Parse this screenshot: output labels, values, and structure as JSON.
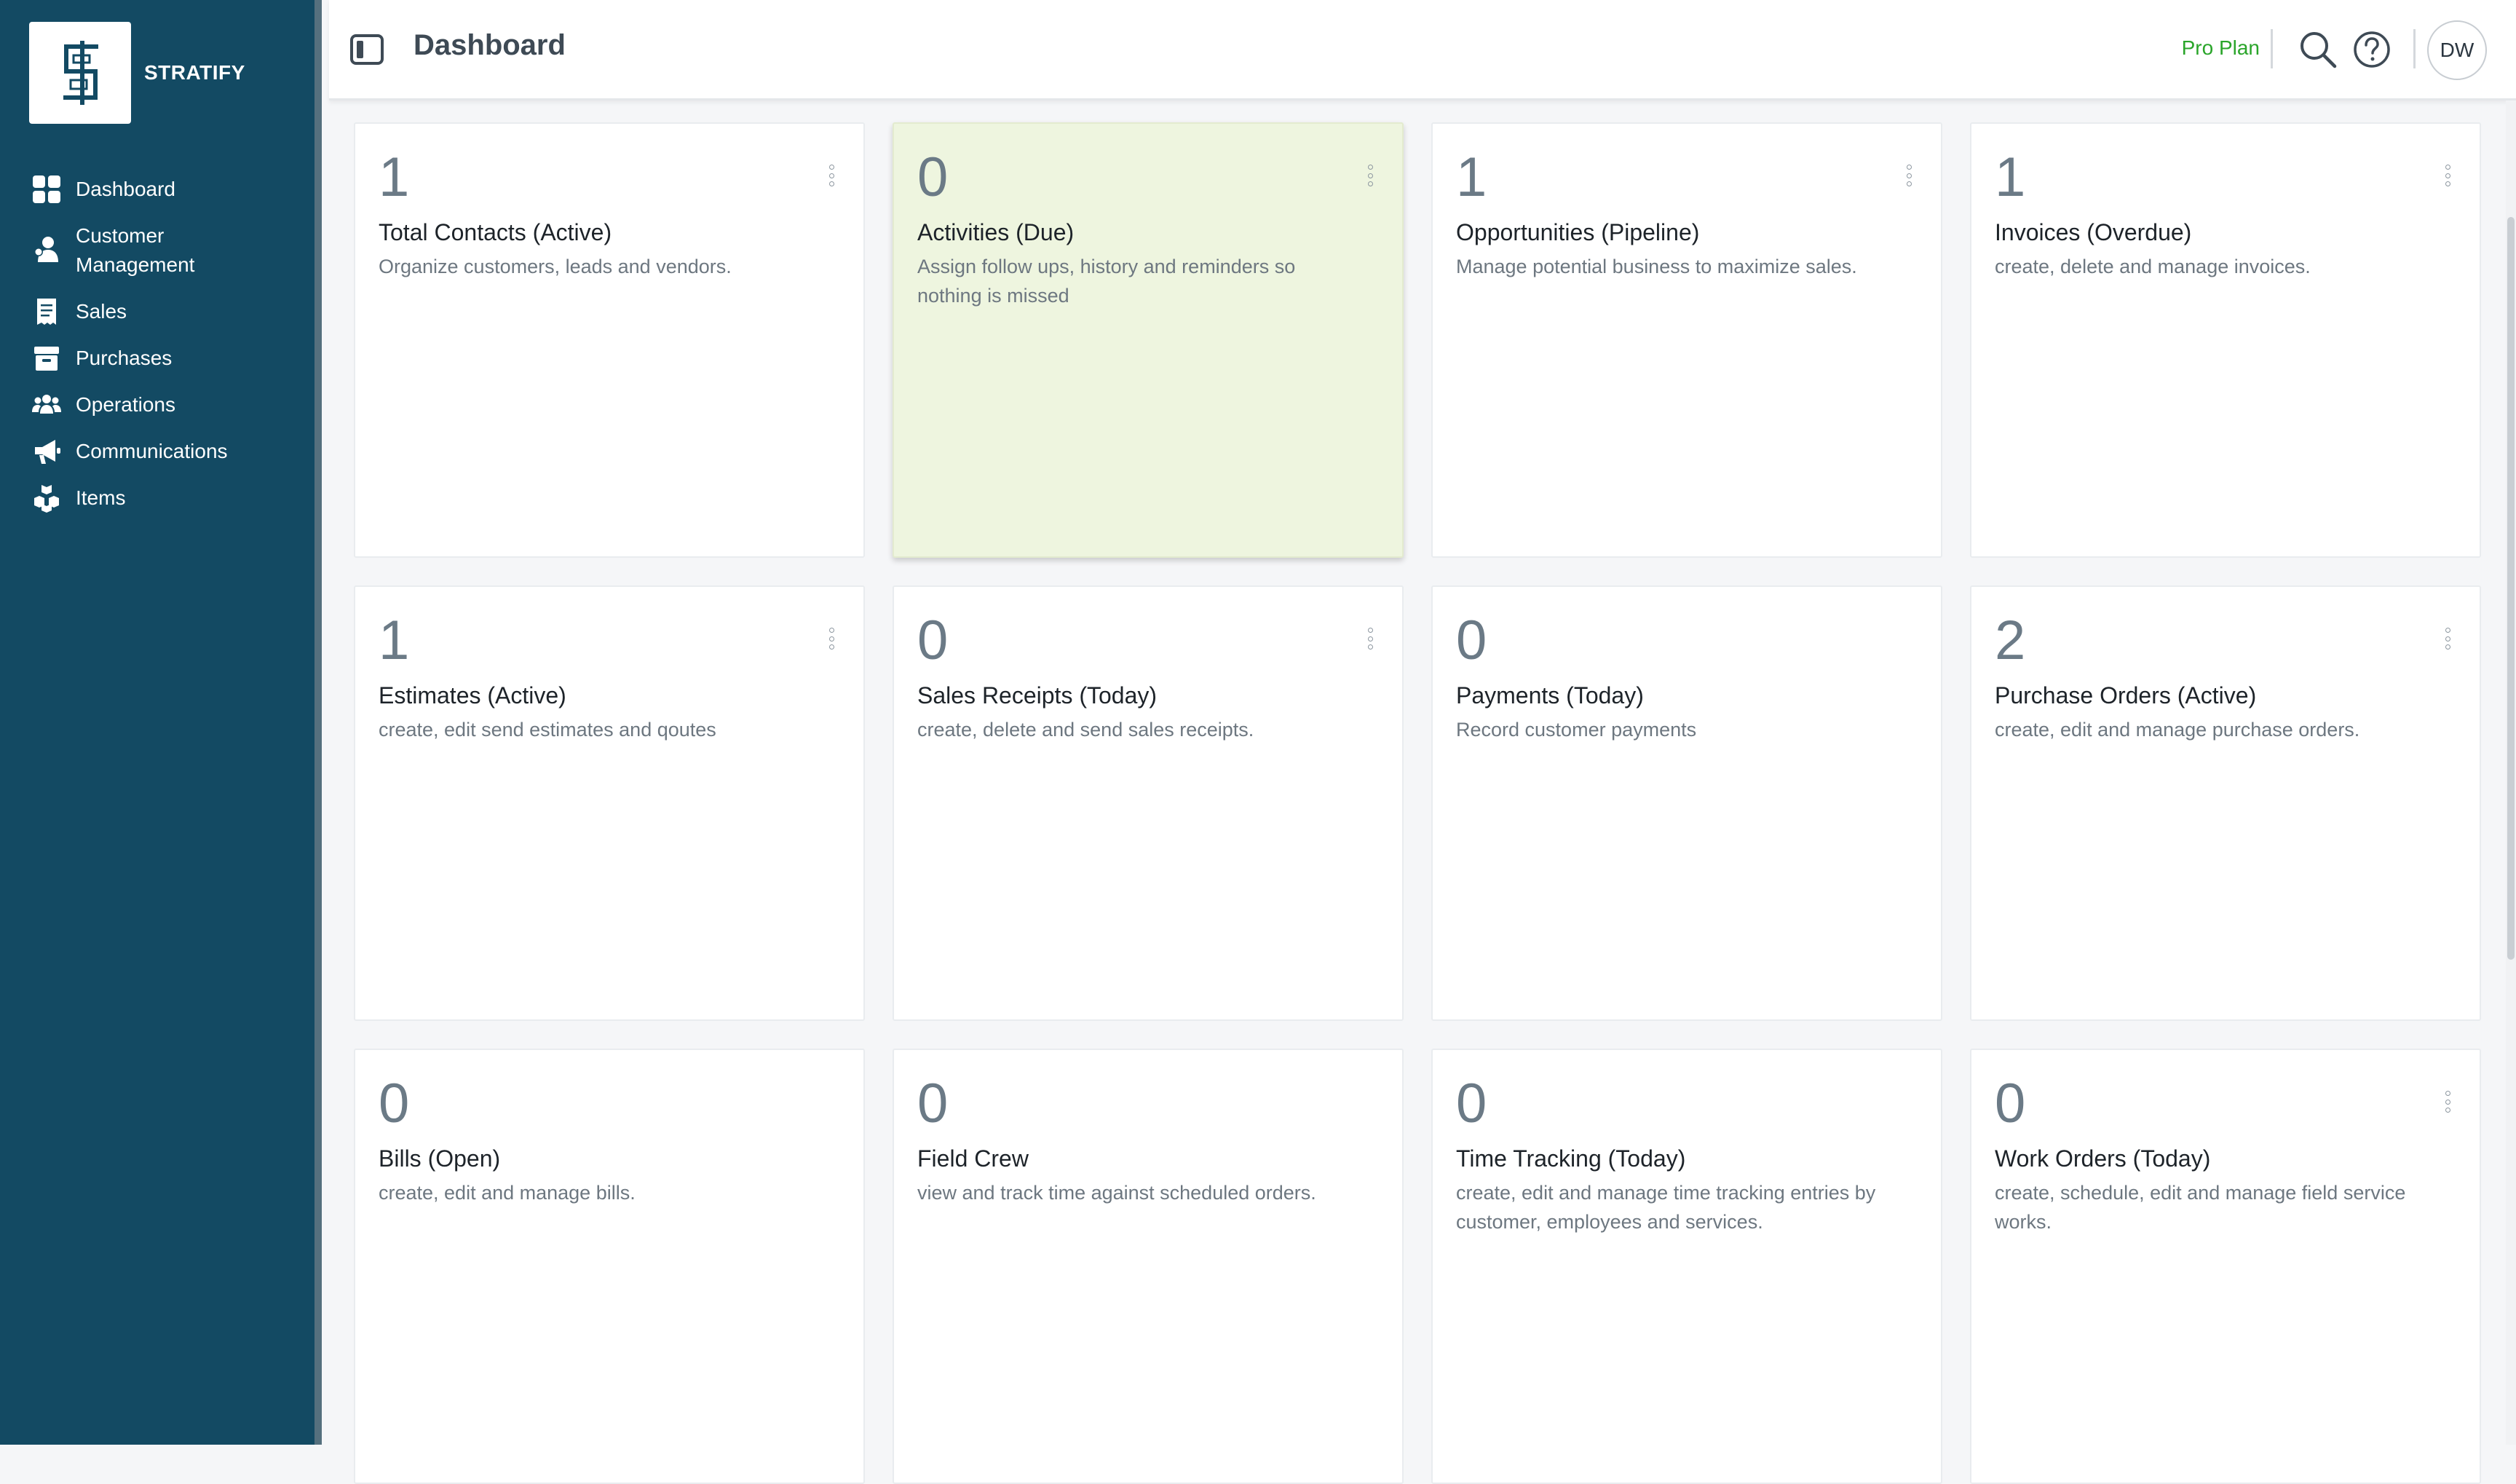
{
  "brand": {
    "name": "STRATIFY",
    "logo_icon": "stratify-logo-icon"
  },
  "sidebar": {
    "items": [
      {
        "label": "Dashboard",
        "icon": "grid-icon"
      },
      {
        "label": "Customer Management",
        "icon": "customer-icon"
      },
      {
        "label": "Sales",
        "icon": "receipt-icon"
      },
      {
        "label": "Purchases",
        "icon": "box-icon"
      },
      {
        "label": "Operations",
        "icon": "team-icon"
      },
      {
        "label": "Communications",
        "icon": "megaphone-icon"
      },
      {
        "label": "Items",
        "icon": "boxes-icon"
      }
    ]
  },
  "header": {
    "title": "Dashboard",
    "plan": "Pro Plan",
    "avatar_initials": "DW"
  },
  "colors": {
    "sidebar_bg": "#134a63",
    "plan_green": "#2aa52a",
    "highlight_card": "#eef5df"
  },
  "cards": [
    {
      "count": "1",
      "title": "Total Contacts (Active)",
      "desc": "Organize customers, leads and vendors."
    },
    {
      "count": "0",
      "title": "Activities (Due)",
      "desc": "Assign follow ups, history and reminders so nothing is missed"
    },
    {
      "count": "1",
      "title": "Opportunities (Pipeline)",
      "desc": "Manage potential business to maximize sales."
    },
    {
      "count": "1",
      "title": "Invoices (Overdue)",
      "desc": "create, delete and manage invoices."
    },
    {
      "count": "1",
      "title": "Estimates (Active)",
      "desc": "create, edit send estimates and qoutes"
    },
    {
      "count": "0",
      "title": "Sales Receipts (Today)",
      "desc": "create, delete and send sales receipts."
    },
    {
      "count": "0",
      "title": "Payments (Today)",
      "desc": "Record customer payments"
    },
    {
      "count": "2",
      "title": "Purchase Orders (Active)",
      "desc": "create, edit and manage purchase orders."
    },
    {
      "count": "0",
      "title": "Bills (Open)",
      "desc": "create, edit and manage bills."
    },
    {
      "count": "0",
      "title": "Field Crew",
      "desc": "view and track time against scheduled orders."
    },
    {
      "count": "0",
      "title": "Time Tracking (Today)",
      "desc": "create, edit and manage time tracking entries by customer, employees and services."
    },
    {
      "count": "0",
      "title": "Work Orders (Today)",
      "desc": "create, schedule, edit and manage field service works."
    }
  ]
}
